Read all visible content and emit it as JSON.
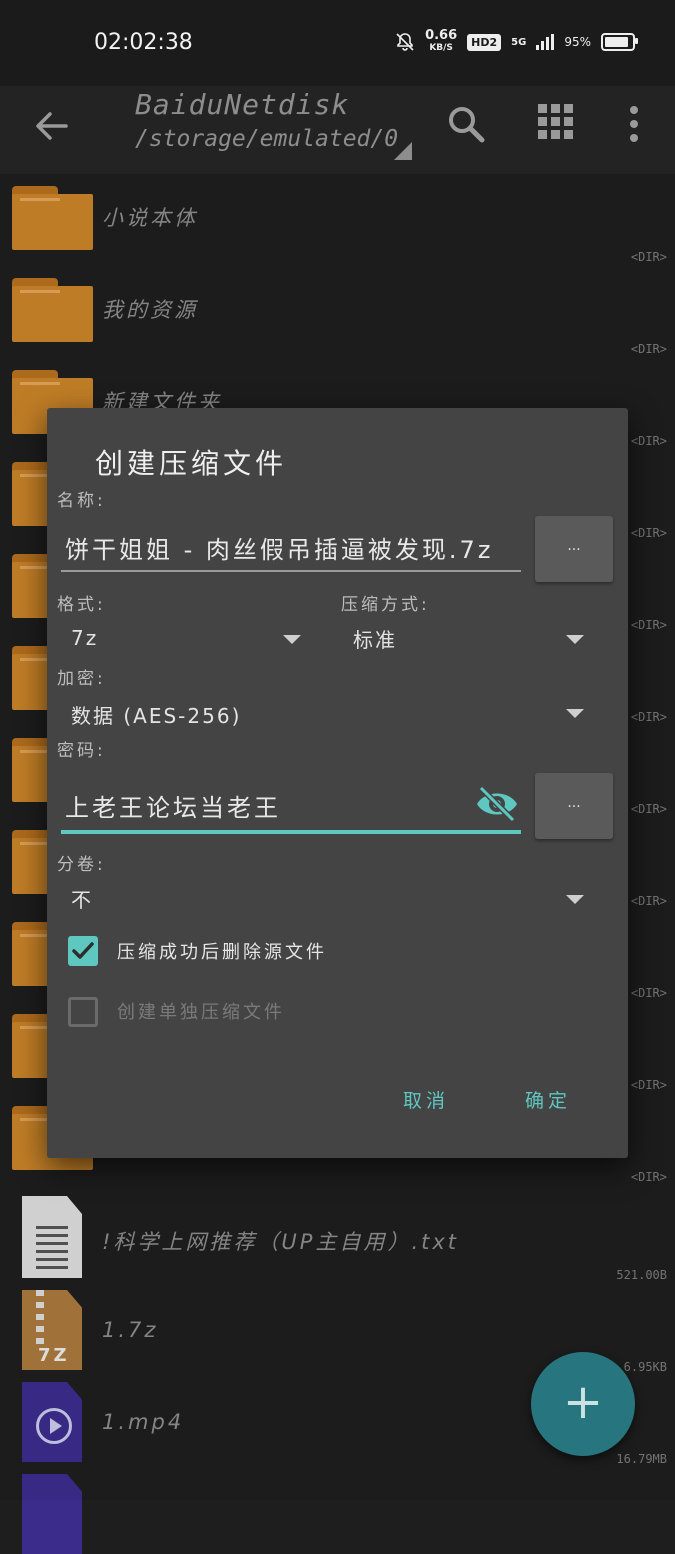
{
  "status_bar": {
    "time": "02:02:38",
    "net_speed": "0.66",
    "net_unit": "KB/S",
    "hd_badge": "HD2",
    "signal_label": "5G",
    "battery_percent": "95%",
    "battery_level": 0.95
  },
  "toolbar": {
    "title": "BaiduNetdisk",
    "path": "/storage/emulated/0"
  },
  "files": [
    {
      "name": "小说本体",
      "meta": "<DIR>",
      "type": "folder"
    },
    {
      "name": "我的资源",
      "meta": "<DIR>",
      "type": "folder"
    },
    {
      "name": "新建文件夹",
      "meta": "<DIR>",
      "type": "folder"
    },
    {
      "name": "",
      "meta": "<DIR>",
      "type": "folder"
    },
    {
      "name": "",
      "meta": "<DIR>",
      "type": "folder"
    },
    {
      "name": "",
      "meta": "<DIR>",
      "type": "folder"
    },
    {
      "name": "",
      "meta": "<DIR>",
      "type": "folder"
    },
    {
      "name": "",
      "meta": "<DIR>",
      "type": "folder"
    },
    {
      "name": "",
      "meta": "<DIR>",
      "type": "folder"
    },
    {
      "name": "",
      "meta": "<DIR>",
      "type": "folder"
    },
    {
      "name": "",
      "meta": "<DIR>",
      "type": "folder"
    },
    {
      "name": "!科学上网推荐（UP主自用）.txt",
      "meta": "521.00B",
      "type": "txt"
    },
    {
      "name": "1.7z",
      "meta": "6.95KB",
      "type": "7z",
      "icon_label": "7Z"
    },
    {
      "name": "1.mp4",
      "meta": "16.79MB",
      "type": "mp4"
    }
  ],
  "dialog": {
    "title": "创建压缩文件",
    "name_label": "名称:",
    "name_value": "饼干姐姐 - 肉丝假吊插逼被发现.7z",
    "browse_button": "...",
    "format_label": "格式:",
    "format_value": "7z",
    "method_label": "压缩方式:",
    "method_value": "标准",
    "encryption_label": "加密:",
    "encryption_value": "数据 (AES-256)",
    "password_label": "密码:",
    "password_value": "上老王论坛当老王",
    "password_button": "...",
    "split_label": "分卷:",
    "split_value": "不",
    "delete_source_label": "压缩成功后删除源文件",
    "delete_source_checked": true,
    "separate_archive_label": "创建单独压缩文件",
    "separate_archive_checked": false,
    "cancel_label": "取消",
    "ok_label": "确定"
  },
  "fab": {
    "label": "+"
  },
  "colors": {
    "accent": "#5ec7bf",
    "dialog_bg": "#444444",
    "folder": "#c98329",
    "fab": "#2a7d86"
  }
}
